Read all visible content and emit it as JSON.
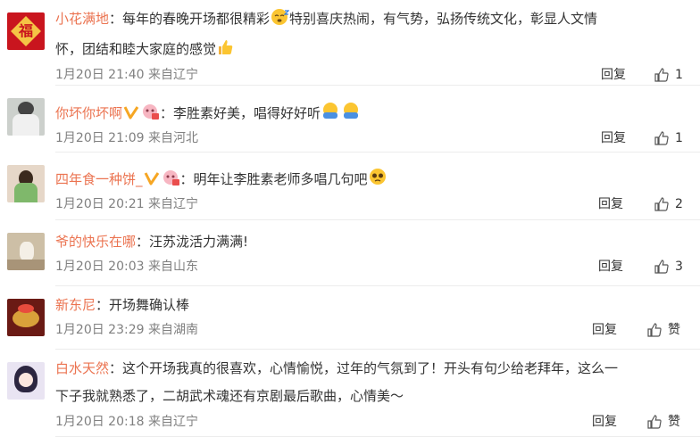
{
  "comments": [
    {
      "user": "小花满地",
      "text_line1": "每年的春晚开场都很精彩",
      "text_line1b": "特别喜庆热闹，有气势，弘扬传统文化，彰显人文情",
      "text_line2": "怀，团结和睦大家庭的感觉",
      "time": "1月20日 21:40 来自辽宁",
      "reply": "回复",
      "likes": "1"
    },
    {
      "user": "你坏你坏啊",
      "text": "李胜素好美，唱得好好听",
      "time": "1月20日 21:09 来自河北",
      "reply": "回复",
      "likes": "1"
    },
    {
      "user": "四年食一种饼_",
      "text": "明年让李胜素老师多唱几句吧",
      "time": "1月20日 20:21 来自辽宁",
      "reply": "回复",
      "likes": "2"
    },
    {
      "user": "爷的快乐在哪",
      "text": "汪苏泷活力满满!",
      "time": "1月20日 20:03 来自山东",
      "reply": "回复",
      "likes": "3"
    },
    {
      "user": "新东尼",
      "text": "开场舞确认棒",
      "time": "1月20日 23:29 来自湖南",
      "reply": "回复",
      "likes": "赞"
    },
    {
      "user": "白水天然",
      "text_line1": "这个开场我真的很喜欢，心情愉悦，过年的气氛到了！开头有句少给老拜年，这么一",
      "text_line2": "下子我就熟悉了，二胡武术魂还有京剧最后歌曲，心情美～",
      "time": "1月20日 20:18 来自辽宁",
      "reply": "回复",
      "likes": "赞"
    }
  ],
  "separator": "：",
  "avatar_fu_char": "福",
  "colors": {
    "username": "#eb7350",
    "meta": "#808080",
    "text": "#333333",
    "vip": "#f6a623"
  }
}
